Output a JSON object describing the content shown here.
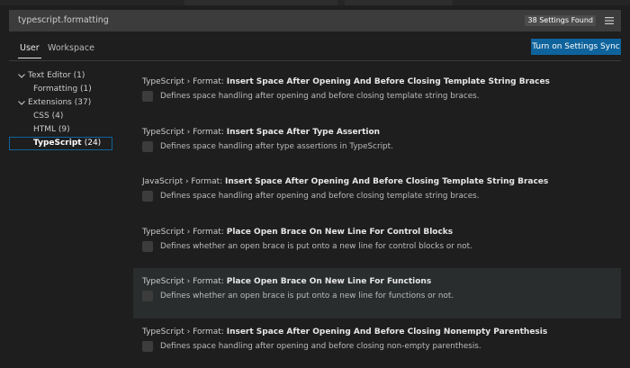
{
  "search": {
    "query": "typescript.formatting",
    "results_badge": "38 Settings Found",
    "filter_icon": "filter-lines-icon"
  },
  "scope_tabs": [
    {
      "label": "User",
      "active": true
    },
    {
      "label": "Workspace",
      "active": false
    }
  ],
  "sync_button": {
    "label": "Turn on Settings Sync"
  },
  "toc": [
    {
      "label": "Text Editor",
      "count": "(1)",
      "expanded": true,
      "level": 0
    },
    {
      "label": "Formatting",
      "count": "(1)",
      "level": 1
    },
    {
      "label": "Extensions",
      "count": "(37)",
      "expanded": true,
      "level": 0
    },
    {
      "label": "CSS",
      "count": "(4)",
      "level": 1
    },
    {
      "label": "HTML",
      "count": "(9)",
      "level": 1
    },
    {
      "label": "TypeScript",
      "count": "(24)",
      "level": 1,
      "selected": true
    }
  ],
  "settings": [
    {
      "category": "TypeScript › Format: ",
      "name": "Insert Space After Opening And Before Closing Template String Braces",
      "description": "Defines space handling after opening and before closing template string braces."
    },
    {
      "category": "TypeScript › Format: ",
      "name": "Insert Space After Type Assertion",
      "description": "Defines space handling after type assertions in TypeScript."
    },
    {
      "category": "JavaScript › Format: ",
      "name": "Insert Space After Opening And Before Closing Template String Braces",
      "description": "Defines space handling after opening and before closing template string braces."
    },
    {
      "category": "TypeScript › Format: ",
      "name": "Place Open Brace On New Line For Control Blocks",
      "description": "Defines whether an open brace is put onto a new line for control blocks or not."
    },
    {
      "category": "TypeScript › Format: ",
      "name": "Place Open Brace On New Line For Functions",
      "description": "Defines whether an open brace is put onto a new line for functions or not.",
      "hovered": true
    },
    {
      "category": "TypeScript › Format: ",
      "name": "Insert Space After Opening And Before Closing Nonempty Parenthesis",
      "description": "Defines space handling after opening and before closing non-empty parenthesis."
    }
  ]
}
